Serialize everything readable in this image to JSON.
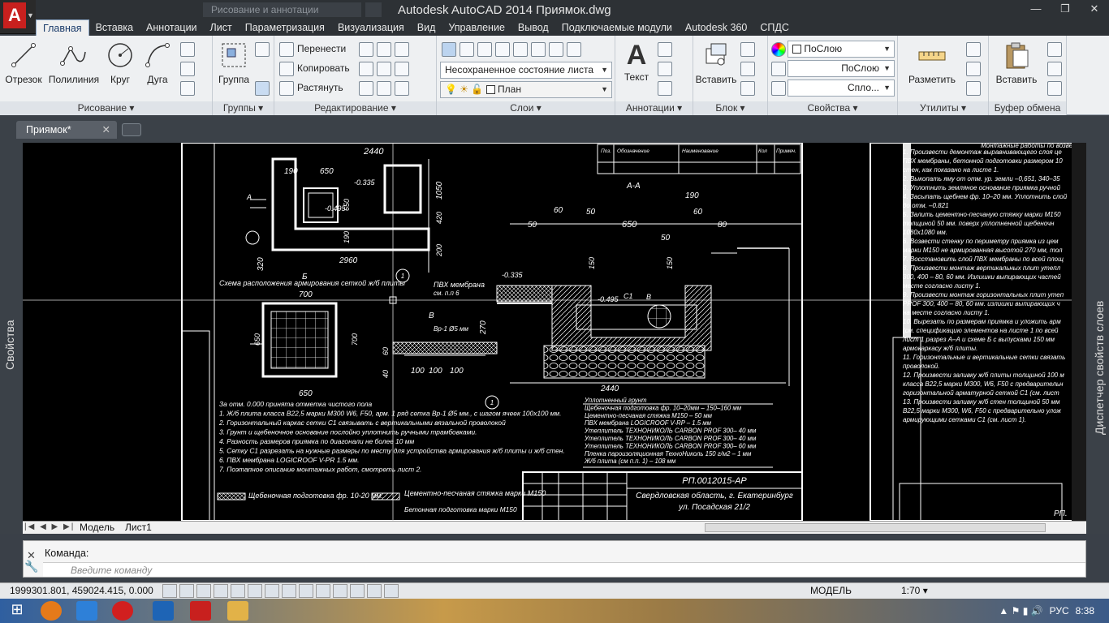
{
  "titlebar": {
    "qa_placeholder": "Рисование и аннотации",
    "title": "Autodesk AutoCAD 2014    Приямок.dwg",
    "win_min": "—",
    "win_max": "❐",
    "win_close": "✕"
  },
  "ribbon_tabs": [
    "Главная",
    "Вставка",
    "Аннотации",
    "Лист",
    "Параметризация",
    "Визуализация",
    "Вид",
    "Управление",
    "Вывод",
    "Подключаемые модули",
    "Autodesk 360",
    "СПДС"
  ],
  "panels": {
    "draw": {
      "title": "Рисование ▾",
      "line": "Отрезок",
      "polyline": "Полилиния",
      "circle": "Круг",
      "arc": "Дуга"
    },
    "groups": {
      "title": "Группы ▾",
      "group": "Группа"
    },
    "modify": {
      "title": "Редактирование ▾",
      "move": "Перенести",
      "copy": "Копировать",
      "stretch": "Растянуть"
    },
    "layers": {
      "title": "Слои ▾",
      "state": "Несохраненное состояние листа",
      "layer": "План"
    },
    "annot": {
      "title": "Аннотации ▾",
      "text": "Текст"
    },
    "block": {
      "title": "Блок ▾",
      "insert": "Вставить"
    },
    "props": {
      "title": "Свойства ▾",
      "color": "ПоСлою",
      "lineweight": "ПоСлою",
      "linetype": "Спло..."
    },
    "utils": {
      "title": "Утилиты ▾",
      "measure": "Разметить"
    },
    "clip": {
      "title": "Буфер обмена",
      "paste": "Вставить"
    }
  },
  "file_tab": {
    "name": "Приямок*",
    "close": "✕"
  },
  "side_left": "Свойства",
  "side_right": "Диспетчер свойств слоев",
  "layout_tabs": {
    "model": "Модель",
    "sheet": "Лист1"
  },
  "command": {
    "label": "Команда:",
    "placeholder": "Введите команду"
  },
  "status": {
    "coords": "1999301.801, 459024.415, 0.000",
    "space": "МОДЕЛЬ",
    "scale": "1:70 ▾"
  },
  "tray": {
    "lang": "РУС",
    "time": "8:38"
  },
  "drawing": {
    "dims": [
      "2440",
      "650",
      "190",
      "-0.335",
      "-0.495",
      "650",
      "190",
      "320",
      "2960",
      "1050",
      "420",
      "200",
      "1",
      "А",
      "Б",
      "700",
      "650",
      "700",
      "650",
      "100",
      "100",
      "100",
      "60",
      "40",
      "В",
      "Вр-1 Ø5 мм",
      "ПВХ мембрана",
      "см. п.п 6",
      "-0.335",
      "270",
      "60",
      "50",
      "50",
      "650",
      "60",
      "80",
      "190",
      "50",
      "150",
      "-0.495",
      "С1",
      "В",
      "150",
      "2440",
      "1",
      "А-А"
    ],
    "schema_title": "Схема расположения армирования сеткой ж/б плиты",
    "notes": [
      "За отм. 0.000 принята отметка чистого пола",
      "1. Ж/б плита класса В22,5 марки М300 W6, F50, арм. 1 ряд сетка Вр-1 Ø5 мм., с шагом ячеек 100х100 мм.",
      "2. Горизонтальный каркас сетки С1 связывать с вертикальными вязальной проволокой",
      "3. Грунт и щебеночное основание послойно уплотнить ручными трамбовками.",
      "4. Разность размеров приямка по диагонали не более 10 мм",
      "5. Сетку С1 разрезать на нужные размеры по месту для устройства армирования ж/б плиты и ж/б стен.",
      "6. ПВХ мембрана LOGICROOF V-PR 1.5 мм.",
      "7. Поэтапное описание монтажных работ, смотреть лист 2."
    ],
    "legend": [
      "Щебеночная подготовка фр. 10-20 мм.",
      "Цементно-песчаная стяжка марки М150",
      "Бетонная подготовка марки М150"
    ],
    "layers_list": [
      "Уплотненный грунт",
      "Щебеночная подготовка фр. 10–20мм – 150–160 мм",
      "Цементно-песчаная стяжка М150 – 50 мм",
      "ПВХ мембрана LOGICROOF V-RP – 1.5 мм",
      "Утеплитель ТЕХНОНИКОЛЬ CARBON PROF 300– 40 мм",
      "Утеплитель ТЕХНОНИКОЛЬ CARBON PROF 300– 40 мм",
      "Утеплитель ТЕХНОНИКОЛЬ CARBON PROF 300– 60 мм",
      "Пленка пароизоляционная ТехноНиколь 150 г/м2 – 1 мм",
      "Ж/б плита (см п.п. 1) – 108 мм"
    ],
    "spec_headers": [
      "Поз.",
      "Обозначение",
      "Наименование",
      "Кол",
      "Примеч."
    ],
    "stamp": {
      "code": "РП.0012015-АР",
      "addr1": "Свердловская область, г. Екатеринбург",
      "addr2": "ул. Посадская 21/2",
      "code2": "РП."
    },
    "right_title": "Монтажные работы по возведению",
    "right_notes": [
      "1. Произвести демонтаж выравнивающего слоя це",
      "ПВХ мембраны, бетонной подготовки размером 10",
      "стен, как показано на листе 1.",
      "2. Выкопать яму от отм. ур. земли –0,651, 340–35",
      "3. Уплотнить земляное основание приямка ручной",
      "4. Засыпать щебнем фр. 10–20 мм. Уплотнить слой",
      "до отм. –0.821",
      "5. Залить цементно-песчаную стяжку марки М150",
      "толщиной 50 мм. поверх уплотненной щебеночн",
      "1080х1080 мм.",
      "6. Возвести стенку по периметру приямка из цем",
      "марки М150 не армированная высотой 270 мм, тол",
      "7. Восстановить слой ПВХ мембраны по всей площ",
      "8. Произвести монтаж вертикальных плит утепл",
      "300, 400 – 80, 60 мм. Излишки выпирающих частей",
      "месте согласно листу 1.",
      "9. Произвести монтаж горизонтальных плит утеп",
      "PROF 300, 400 – 80, 60 мм. излишки выпирающих ч",
      "на месте согласно листу 1.",
      "10. Вырезать по размерам приямка и уложить арм",
      "(см. спецификацию элементов на листе 1 по всей",
      "лист 1 разрез А–А и схеме Б с выпусками 150 мм",
      "армокаркасу ж/б плиты.",
      "11. Горизонтальные и вертикальные сетки связать",
      "проволокой.",
      "12. Произвести заливку ж/б плиты толщиной 100 м",
      "класса В22,5 марки М300, W6, F50 с предварительн",
      "горизонтальной арматурной сеткой С1 (см. лист",
      "13. Произвести заливку ж/б стен толщиной 50 мм",
      "В22,5 марки М300, W6, F50 с предварительно улож",
      "армирующими сетками С1 (см. лист 1)."
    ]
  }
}
